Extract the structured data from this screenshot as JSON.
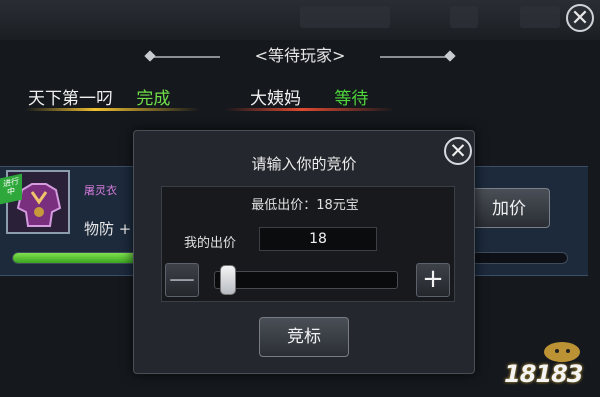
{
  "header": {
    "title": "<等待玩家>"
  },
  "players": [
    {
      "name": "天下第一叼",
      "status": "完成",
      "status_color": "#6fe048"
    },
    {
      "name": "大姨妈",
      "status": "等待",
      "status_color": "#4ed73a"
    }
  ],
  "auction": {
    "badge": "进行中",
    "item_name": "屠灵衣",
    "item_stat": "物防 +",
    "raise_button": "加价",
    "progress_fraction": 0.22
  },
  "dialog": {
    "title": "请输入你的竞价",
    "min_bid": "最低出价：18元宝",
    "my_bid_label": "我的出价",
    "my_bid_value": "18",
    "minus": "—",
    "plus": "+",
    "bid_button": "竞标",
    "close": "✕",
    "slider_fraction": 0.0
  },
  "main_close": "✕",
  "watermark": "18183",
  "colors": {
    "accent_green": "#4ed73a",
    "panel_blue": "#1c2a3c"
  }
}
